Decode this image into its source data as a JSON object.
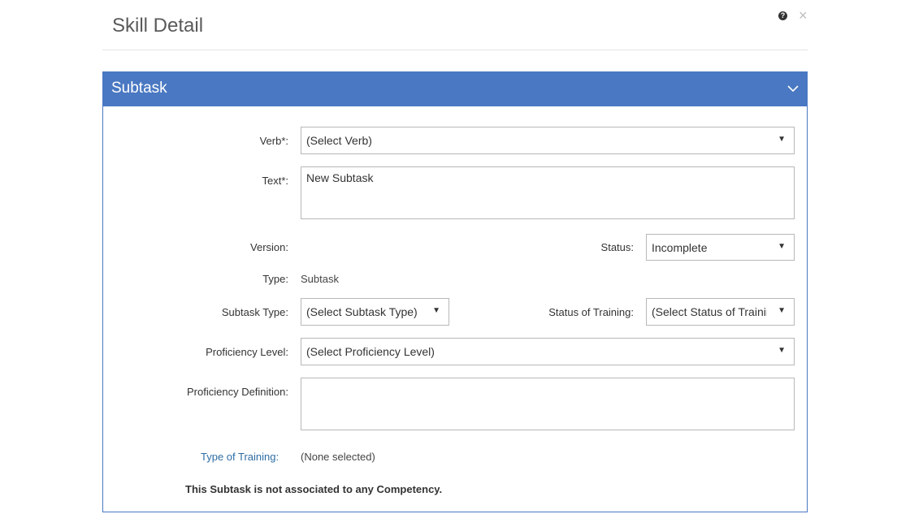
{
  "dialog": {
    "title": "Skill Detail",
    "help_icon": "?",
    "close_icon": "×"
  },
  "panel": {
    "title": "Subtask",
    "accent_color": "#4a78c2"
  },
  "form": {
    "verb": {
      "label": "Verb*:",
      "value": "(Select Verb)"
    },
    "text": {
      "label": "Text*:",
      "value": "New Subtask"
    },
    "version": {
      "label": "Version:",
      "value": ""
    },
    "status": {
      "label": "Status:",
      "value": "Incomplete"
    },
    "type": {
      "label": "Type:",
      "value": "Subtask"
    },
    "subtask_type": {
      "label": "Subtask Type:",
      "value": "(Select Subtask Type)"
    },
    "status_of_training": {
      "label": "Status of Training:",
      "value": "(Select Status of Training)"
    },
    "proficiency_level": {
      "label": "Proficiency Level:",
      "value": "(Select Proficiency Level)"
    },
    "proficiency_definition": {
      "label": "Proficiency Definition:",
      "value": ""
    },
    "type_of_training": {
      "label": "Type of Training:",
      "value": "(None selected)"
    }
  },
  "note": "This Subtask is not associated to any Competency."
}
